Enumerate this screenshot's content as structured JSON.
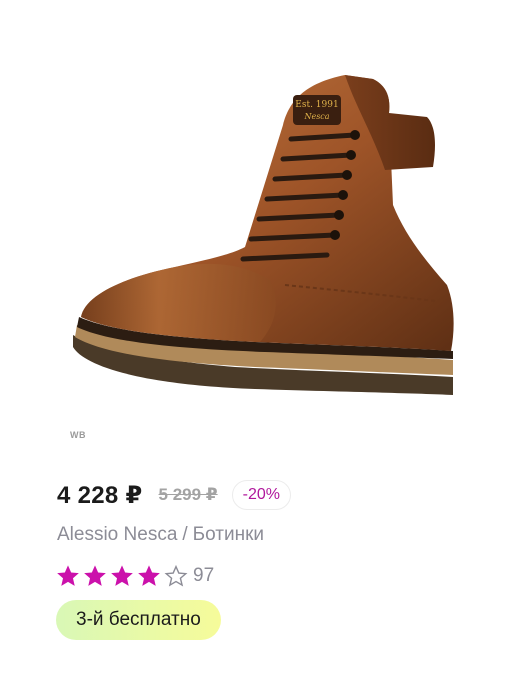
{
  "product": {
    "image_alt": "brown leather lace-up boot",
    "image_logo_text": ".Est. 1991",
    "watermark": "WB",
    "price": "4 228 ₽",
    "old_price": "5 299 ₽",
    "discount": "-20%",
    "brand": "Alessio Nesca",
    "separator": "/",
    "category": "Ботинки",
    "rating": 4,
    "rating_max": 5,
    "reviews_count": "97",
    "promo": "3-й бесплатно"
  },
  "colors": {
    "accent_magenta": "#cb11ab",
    "discount_text": "#b0179c",
    "muted_text": "#8c8c96",
    "promo_gradient_start": "#d9f8b6",
    "promo_gradient_end": "#f6fb9a"
  },
  "icons": {
    "star_filled": "star-filled-icon",
    "star_empty": "star-outline-icon"
  }
}
